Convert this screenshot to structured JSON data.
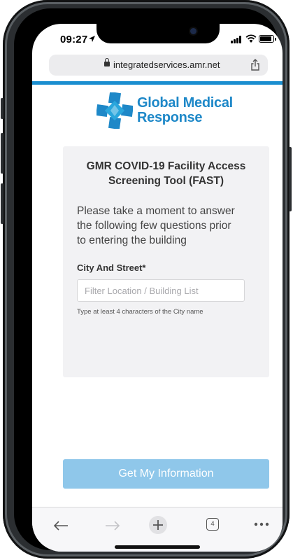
{
  "status_bar": {
    "time": "09:27"
  },
  "browser": {
    "url": "integratedservices.amr.net",
    "tab_count": "4"
  },
  "brand": {
    "line1": "Global Medical",
    "line2": "Response",
    "color": "#1e88c8"
  },
  "form": {
    "title_line1": "GMR COVID-19 Facility Access",
    "title_line2": "Screening Tool (FAST)",
    "intro_line1": "Please take a moment to answer",
    "intro_line2": "the following few questions prior",
    "intro_line3": "to entering the building",
    "field_label": "City And Street*",
    "field_value": "",
    "field_placeholder": "Filter Location / Building List",
    "field_help": "Type at least 4 characters of the City name"
  },
  "actions": {
    "submit_label": "Get My Information"
  },
  "toolbar_icons": [
    "back-icon",
    "forward-icon",
    "new-tab-icon",
    "tabs-icon",
    "more-icon"
  ],
  "colors": {
    "accent": "#1a8ed0",
    "button": "#8fc7ea"
  }
}
